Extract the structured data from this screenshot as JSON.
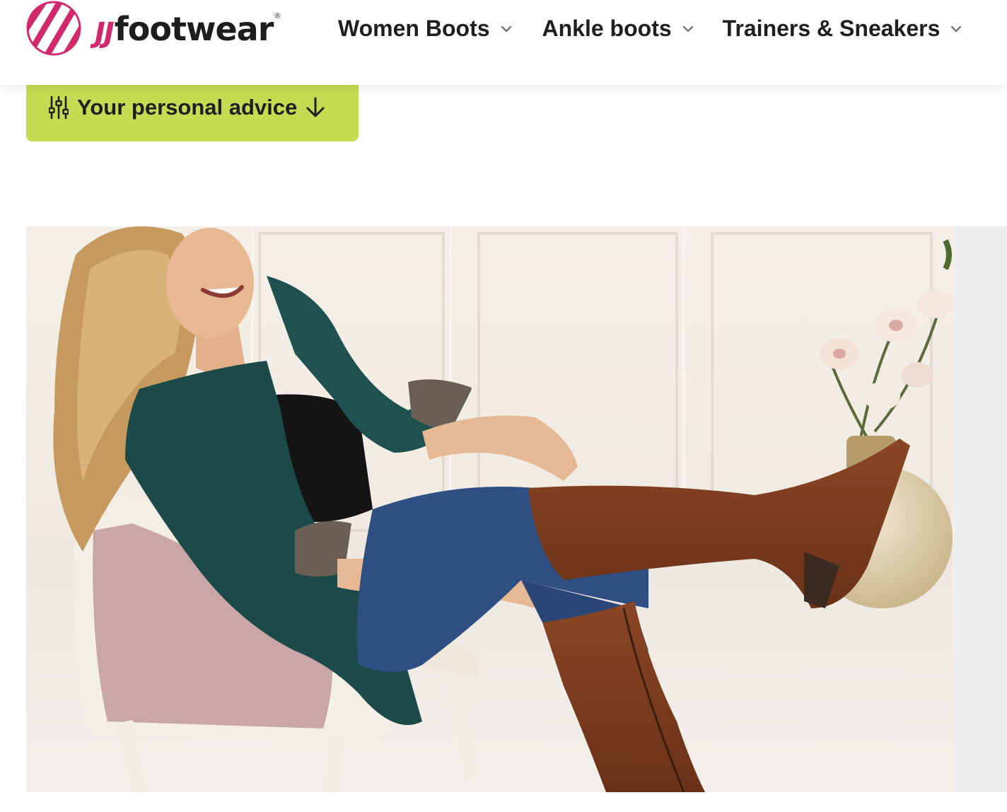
{
  "brand": {
    "prefix": "JJ",
    "name": "footwear",
    "registered": "®",
    "logo_icon": "striped-globe-icon",
    "colors": {
      "accent": "#d12a6c",
      "text": "#1d1d1d"
    }
  },
  "nav": {
    "items": [
      {
        "label": "Women Boots",
        "icon": "chevron-down-icon"
      },
      {
        "label": "Ankle boots",
        "icon": "chevron-down-icon"
      },
      {
        "label": "Trainers & Sneakers",
        "icon": "chevron-down-icon"
      }
    ]
  },
  "advice_button": {
    "label": "Your personal advice",
    "icon_left": "sliders-icon",
    "icon_right": "arrow-down-icon",
    "color": "#c5dc52"
  },
  "hero": {
    "image_subject": "woman-pulling-on-brown-knee-boots",
    "colors": {
      "background": "#efe9e1",
      "jacket": "#1c4a48",
      "boot": "#7a3b1d",
      "jeans": "#2f4e82"
    }
  }
}
